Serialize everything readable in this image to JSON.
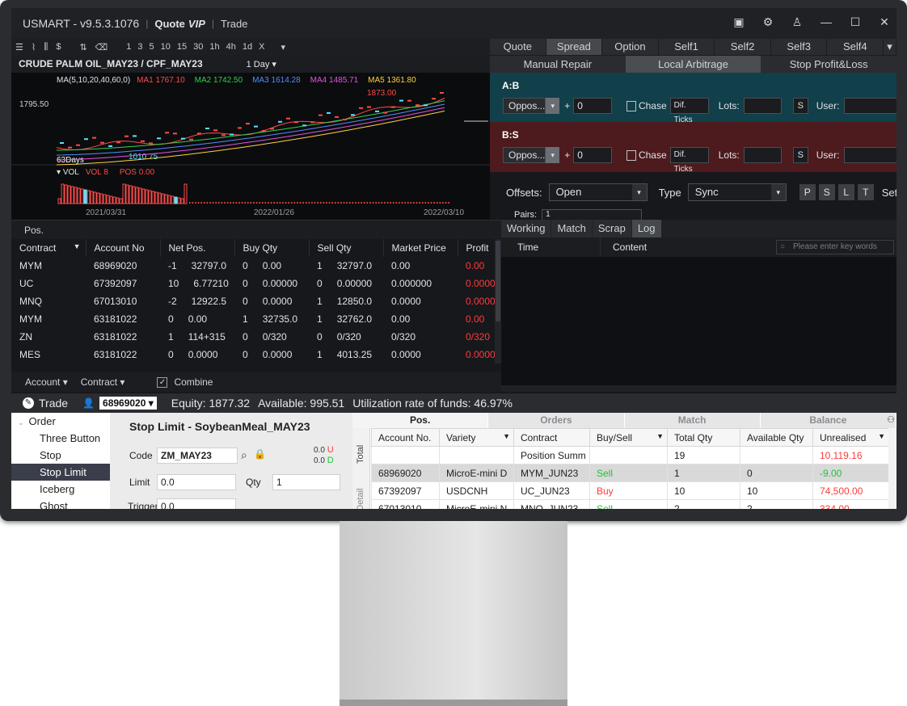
{
  "app": {
    "title": "USMART - v9.5.3.1076",
    "quote": "Quote",
    "vip": "VIP",
    "trade": "Trade"
  },
  "chart": {
    "tools_periods": [
      "1",
      "3",
      "5",
      "10",
      "15",
      "30",
      "1h",
      "4h",
      "1d",
      "X"
    ],
    "symbol": "CRUDE PALM OIL_MAY23 / CPF_MAY23",
    "period": "1 Day",
    "ma_header": "MA(5,10,20,40,60,0)",
    "ma": [
      {
        "label": "MA1 1767.10",
        "color": "#ff4a4a"
      },
      {
        "label": "MA2 1742.50",
        "color": "#2fd14b"
      },
      {
        "label": "MA3 1614.28",
        "color": "#4f8dff"
      },
      {
        "label": "MA4 1485.71",
        "color": "#e052e0"
      },
      {
        "label": "MA5 1361.80",
        "color": "#ffd23a"
      }
    ],
    "price_label": "1795.50",
    "high_label": "1873.00",
    "low_label": "1010.75",
    "days_label": "63Days",
    "vol_header": "VOL",
    "vol_value": "VOL 8",
    "pos_value": "POS 0.00",
    "dates": [
      "2021/03/31",
      "2022/01/26",
      "2022/03/10"
    ]
  },
  "right_tabs": [
    "Quote",
    "Spread",
    "Option",
    "Self1",
    "Self2",
    "Self3",
    "Self4"
  ],
  "right_subtabs": [
    "Manual Repair",
    "Local Arbitrage",
    "Stop Profit&Loss"
  ],
  "pair_ab": {
    "label": "A:B",
    "select": "Oppos...",
    "plus": "+",
    "spin": "0",
    "chase": "Chase",
    "dif": "Dif. Ticks",
    "lots": "Lots:",
    "s": "S",
    "user": "User:"
  },
  "pair_bs": {
    "label": "B:S",
    "select": "Oppos...",
    "plus": "+",
    "spin": "0",
    "chase": "Chase",
    "dif": "Dif. Ticks",
    "lots": "Lots:",
    "s": "S",
    "user": "User:"
  },
  "options": {
    "offsets_label": "Offsets:",
    "offsets_value": "Open",
    "type_label": "Type",
    "type_value": "Sync",
    "buttons": [
      "P",
      "S",
      "L",
      "T"
    ],
    "set": "Set",
    "pairs_label": "Pairs:",
    "pairs_value": "1"
  },
  "pos": {
    "label": "Pos.",
    "columns": [
      "Contract",
      "Account No",
      "Net Pos.",
      "Buy Qty",
      "Sell Qty",
      "Market Price",
      "Profit"
    ],
    "rows": [
      [
        "MYM",
        "68969020",
        "-1",
        "32797.0",
        "0",
        "0.00",
        "1",
        "32797.0",
        "0.00",
        "0.00"
      ],
      [
        "UC",
        "67392097",
        "10",
        "6.77210",
        "0",
        "0.00000",
        "0",
        "0.00000",
        "0.000000",
        "0.0000"
      ],
      [
        "MNQ",
        "67013010",
        "-2",
        "12922.5",
        "0",
        "0.0000",
        "1",
        "12850.0",
        "0.0000",
        "0.0000"
      ],
      [
        "MYM",
        "63181022",
        "0",
        "0.00",
        "1",
        "32735.0",
        "1",
        "32762.0",
        "0.00",
        "0.00"
      ],
      [
        "ZN",
        "63181022",
        "1",
        "114+315",
        "0",
        "0/320",
        "0",
        "0/320",
        "0/320",
        "0/320"
      ],
      [
        "MES",
        "63181022",
        "0",
        "0.0000",
        "0",
        "0.0000",
        "1",
        "4013.25",
        "0.0000",
        "0.0000"
      ]
    ],
    "foot_account": "Account",
    "foot_contract": "Contract",
    "foot_combine": "Combine"
  },
  "log": {
    "tabs": [
      "Working",
      "Match",
      "Scrap",
      "Log"
    ],
    "col_time": "Time",
    "col_content": "Content",
    "search_placeholder": "Please enter key words"
  },
  "trade_bar": {
    "trade": "Trade",
    "account": "68969020",
    "equity": "Equity: 1877.32",
    "available": "Available: 995.51",
    "utilization": "Utilization rate of funds: 46.97%"
  },
  "order_types": {
    "root": "Order",
    "items": [
      "Three Button",
      "Stop",
      "Stop Limit",
      "Iceberg",
      "Ghost"
    ]
  },
  "order_form": {
    "title": "Stop Limit - SoybeanMeal_MAY23",
    "code_label": "Code",
    "code_value": "ZM_MAY23",
    "u_val": "0.0",
    "u": "U",
    "d_val": "0.0",
    "d": "D",
    "limit_label": "Limit",
    "limit_value": "0.0",
    "qty_label": "Qty",
    "qty_value": "1",
    "trigger_label": "Trigger",
    "trigger_value": "0.0"
  },
  "positions": {
    "tabs": [
      "Pos.",
      "Orders",
      "Match",
      "Balance"
    ],
    "side_total": "Total",
    "side_detail": "nd Detail",
    "columns": [
      "Account No.",
      "Variety",
      "Contract",
      "Buy/Sell",
      "Total Qty",
      "Available Qty",
      "Unrealised"
    ],
    "summary": {
      "contract": "Position Summ",
      "total": "19",
      "unrealised": "10,119.16"
    },
    "rows": [
      {
        "acct": "68969020",
        "variety": "MicroE-mini D",
        "contract": "MYM_JUN23",
        "side": "Sell",
        "total": "1",
        "avail": "0",
        "unreal": "-9.00"
      },
      {
        "acct": "67392097",
        "variety": "USDCNH",
        "contract": "UC_JUN23",
        "side": "Buy",
        "total": "10",
        "avail": "10",
        "unreal": "74,500.00"
      },
      {
        "acct": "67013010",
        "variety": "MicroE-mini N",
        "contract": "MNQ_JUN23",
        "side": "Sell",
        "total": "2",
        "avail": "2",
        "unreal": "334.00"
      }
    ]
  }
}
